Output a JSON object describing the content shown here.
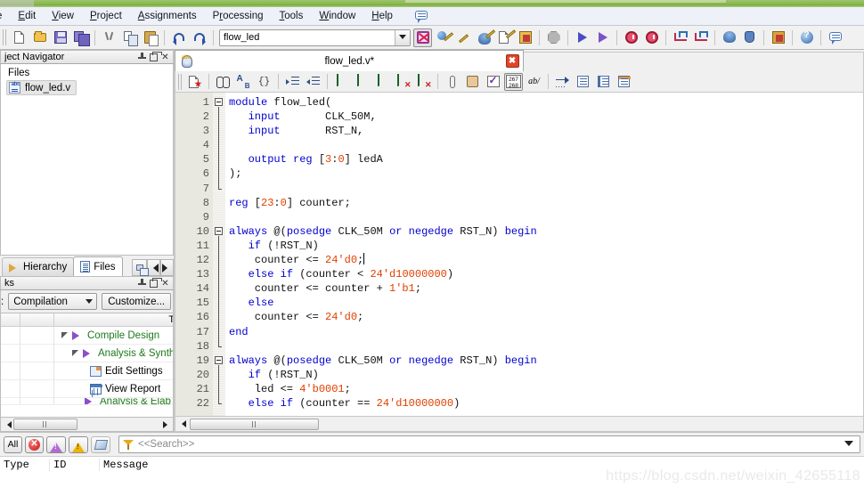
{
  "window": {
    "title_strip_color": "#8fba57"
  },
  "menubar": {
    "items": [
      {
        "label": "e",
        "truncated": true
      },
      {
        "label": "Edit"
      },
      {
        "label": "View"
      },
      {
        "label": "Project"
      },
      {
        "label": "Assignments"
      },
      {
        "label": "Processing"
      },
      {
        "label": "Tools"
      },
      {
        "label": "Window"
      },
      {
        "label": "Help"
      }
    ],
    "note_icon": "message-balloon-icon"
  },
  "toolbar": {
    "project_combo_value": "flow_led",
    "buttons": [
      {
        "name": "new-file-button",
        "icon": "new-document-icon"
      },
      {
        "name": "open-file-button",
        "icon": "open-folder-icon"
      },
      {
        "name": "save-file-button",
        "icon": "save-floppy-icon"
      },
      {
        "name": "save-all-button",
        "icon": "save-all-icon"
      },
      {
        "name": "cut-button",
        "icon": "scissors-icon"
      },
      {
        "name": "copy-button",
        "icon": "copy-icon"
      },
      {
        "name": "paste-button",
        "icon": "paste-icon"
      },
      {
        "name": "undo-button",
        "icon": "undo-arrow-icon"
      },
      {
        "name": "redo-button",
        "icon": "redo-arrow-icon"
      },
      {
        "name": "device-button",
        "icon": "chip-x-icon"
      },
      {
        "name": "assignment-editor-button",
        "icon": "pencil-ball-icon"
      },
      {
        "name": "pin-planner-button",
        "icon": "pencil-icon"
      },
      {
        "name": "settings-button",
        "icon": "settings-pencil-icon"
      },
      {
        "name": "compiler-settings-button",
        "icon": "compiler-pencil-icon"
      },
      {
        "name": "simulator-settings-button",
        "icon": "simulator-icon"
      },
      {
        "name": "stop-button",
        "icon": "stop-sign-icon"
      },
      {
        "name": "start-compilation-button",
        "icon": "play-icon"
      },
      {
        "name": "start-analysis-button",
        "icon": "play-check-icon"
      },
      {
        "name": "timing-analyzer-button",
        "icon": "stopwatch-icon"
      },
      {
        "name": "timing-analyzer-2-button",
        "icon": "stopwatch-2-icon"
      },
      {
        "name": "waveform-button",
        "icon": "waveform-in-icon"
      },
      {
        "name": "waveform-out-button",
        "icon": "waveform-out-icon"
      },
      {
        "name": "programmer-download-button",
        "icon": "download-icon"
      },
      {
        "name": "signaltap-button",
        "icon": "hand-icon"
      },
      {
        "name": "programmer-button",
        "icon": "programmer-icon"
      },
      {
        "name": "help-button",
        "icon": "help-circle-icon"
      },
      {
        "name": "message-button",
        "icon": "message-balloon-icon"
      }
    ]
  },
  "navigator": {
    "title": "ject Navigator",
    "full_title": "Project Navigator",
    "section_label": "Files",
    "file": {
      "name": "flow_led.v",
      "icon": "verilog-file-icon"
    },
    "tabs": [
      {
        "label": "Hierarchy",
        "icon": "hierarchy-icon",
        "active": false
      },
      {
        "label": "Files",
        "icon": "files-icon",
        "active": true
      }
    ]
  },
  "tasks": {
    "title": "ks",
    "full_title": "Tasks",
    "flow_label": ":",
    "flow_value": "Compilation",
    "customize_label": "Customize...",
    "column_header": "Tas",
    "column_header_full": "Task",
    "rows": [
      {
        "label": "Compile Design",
        "indent": 1,
        "icon": "purple-arrow-icon",
        "expander": true,
        "color": "green"
      },
      {
        "label": "Analysis & Synthes",
        "indent": 2,
        "icon": "purple-arrow-icon",
        "expander": true,
        "color": "green"
      },
      {
        "label": "Edit Settings",
        "indent": 3,
        "icon": "edit-settings-icon",
        "expander": false,
        "color": "black"
      },
      {
        "label": "View Report",
        "indent": 3,
        "icon": "view-report-icon",
        "expander": false,
        "color": "black"
      },
      {
        "label": "Analysis & Elab",
        "indent": 3,
        "icon": "purple-arrow-icon",
        "expander": false,
        "color": "green",
        "partial": true
      }
    ]
  },
  "editor": {
    "tab_title": "flow_led.v*",
    "tab_icon": "verilog-blue-icon",
    "close_label": "✖",
    "toolbar_buttons": [
      {
        "name": "insert-template-button",
        "icon": "insert-template-icon"
      },
      {
        "name": "find-button",
        "icon": "binoculars-icon"
      },
      {
        "name": "replace-button",
        "icon": "replace-az-icon"
      },
      {
        "name": "goto-button",
        "icon": "goto-arrow-icon"
      },
      {
        "name": "increase-indent-button",
        "icon": "indent-increase-icon"
      },
      {
        "name": "decrease-indent-button",
        "icon": "indent-decrease-icon"
      },
      {
        "name": "toggle-bookmark-button",
        "icon": "bookmark-icon"
      },
      {
        "name": "next-bookmark-button",
        "icon": "bookmark-next-icon"
      },
      {
        "name": "previous-bookmark-button",
        "icon": "bookmark-prev-icon"
      },
      {
        "name": "clear-bookmark-button",
        "icon": "bookmark-clear-icon"
      },
      {
        "name": "clear-all-bookmarks-button",
        "icon": "bookmark-clear-all-icon"
      },
      {
        "name": "attach-button",
        "icon": "paperclip-icon"
      },
      {
        "name": "script-button",
        "icon": "scroll-icon"
      },
      {
        "name": "syntax-check-button",
        "icon": "check-document-icon"
      },
      {
        "name": "line-numbers-button",
        "icon": "line-numbers-267-268-icon",
        "label_top": "267",
        "label_bottom": "268"
      },
      {
        "name": "toggle-case-button",
        "icon": "ab-slash-icon",
        "label": "ab/"
      },
      {
        "name": "goto-line-button",
        "icon": "goto-line-icon"
      },
      {
        "name": "show-all-button",
        "icon": "page-list-icon"
      },
      {
        "name": "split-view-button",
        "icon": "page-split-icon"
      },
      {
        "name": "header-view-button",
        "icon": "page-header-icon"
      }
    ],
    "first_line": 1,
    "last_line": 22,
    "fold_lines": [
      1,
      10,
      19
    ],
    "code_lines": [
      {
        "n": 1,
        "tokens": [
          {
            "t": "module",
            "c": "kw"
          },
          {
            "t": " flow_led(",
            "c": ""
          }
        ]
      },
      {
        "n": 2,
        "tokens": [
          {
            "t": "   ",
            "c": ""
          },
          {
            "t": "input",
            "c": "kw"
          },
          {
            "t": "       CLK_50M,",
            "c": ""
          }
        ]
      },
      {
        "n": 3,
        "tokens": [
          {
            "t": "   ",
            "c": ""
          },
          {
            "t": "input",
            "c": "kw"
          },
          {
            "t": "       RST_N,",
            "c": ""
          }
        ]
      },
      {
        "n": 4,
        "tokens": []
      },
      {
        "n": 5,
        "tokens": [
          {
            "t": "   ",
            "c": ""
          },
          {
            "t": "output reg",
            "c": "kw"
          },
          {
            "t": " [",
            "c": ""
          },
          {
            "t": "3",
            "c": "num"
          },
          {
            "t": ":",
            "c": ""
          },
          {
            "t": "0",
            "c": "num"
          },
          {
            "t": "] ledA",
            "c": ""
          }
        ]
      },
      {
        "n": 6,
        "tokens": [
          {
            "t": ");",
            "c": ""
          }
        ]
      },
      {
        "n": 7,
        "tokens": []
      },
      {
        "n": 8,
        "tokens": [
          {
            "t": "reg",
            "c": "kw"
          },
          {
            "t": " [",
            "c": ""
          },
          {
            "t": "23",
            "c": "num"
          },
          {
            "t": ":",
            "c": ""
          },
          {
            "t": "0",
            "c": "num"
          },
          {
            "t": "] counter;",
            "c": ""
          }
        ]
      },
      {
        "n": 9,
        "tokens": []
      },
      {
        "n": 10,
        "tokens": [
          {
            "t": "always",
            "c": "kw"
          },
          {
            "t": " @(",
            "c": ""
          },
          {
            "t": "posedge",
            "c": "kw"
          },
          {
            "t": " CLK_50M ",
            "c": ""
          },
          {
            "t": "or",
            "c": "kw"
          },
          {
            "t": " ",
            "c": ""
          },
          {
            "t": "negedge",
            "c": "kw"
          },
          {
            "t": " RST_N) ",
            "c": ""
          },
          {
            "t": "begin",
            "c": "kw"
          }
        ]
      },
      {
        "n": 11,
        "tokens": [
          {
            "t": "   ",
            "c": ""
          },
          {
            "t": "if",
            "c": "kw"
          },
          {
            "t": " (!RST_N)",
            "c": ""
          }
        ]
      },
      {
        "n": 12,
        "tokens": [
          {
            "t": "    counter <= ",
            "c": ""
          },
          {
            "t": "24'd0",
            "c": "num"
          },
          {
            "t": ";",
            "c": ""
          }
        ],
        "cursor_at_end": true
      },
      {
        "n": 13,
        "tokens": [
          {
            "t": "   ",
            "c": ""
          },
          {
            "t": "else if",
            "c": "kw"
          },
          {
            "t": " (counter < ",
            "c": ""
          },
          {
            "t": "24'd10000000",
            "c": "num"
          },
          {
            "t": ")",
            "c": ""
          }
        ]
      },
      {
        "n": 14,
        "tokens": [
          {
            "t": "    counter <= counter + ",
            "c": ""
          },
          {
            "t": "1'b1",
            "c": "num"
          },
          {
            "t": ";",
            "c": ""
          }
        ]
      },
      {
        "n": 15,
        "tokens": [
          {
            "t": "   ",
            "c": ""
          },
          {
            "t": "else",
            "c": "kw"
          }
        ]
      },
      {
        "n": 16,
        "tokens": [
          {
            "t": "    counter <= ",
            "c": ""
          },
          {
            "t": "24'd0",
            "c": "num"
          },
          {
            "t": ";",
            "c": ""
          }
        ]
      },
      {
        "n": 17,
        "tokens": [
          {
            "t": "end",
            "c": "kw"
          }
        ]
      },
      {
        "n": 18,
        "tokens": []
      },
      {
        "n": 19,
        "tokens": [
          {
            "t": "always",
            "c": "kw"
          },
          {
            "t": " @(",
            "c": ""
          },
          {
            "t": "posedge",
            "c": "kw"
          },
          {
            "t": " CLK_50M ",
            "c": ""
          },
          {
            "t": "or",
            "c": "kw"
          },
          {
            "t": " ",
            "c": ""
          },
          {
            "t": "negedge",
            "c": "kw"
          },
          {
            "t": " RST_N) ",
            "c": ""
          },
          {
            "t": "begin",
            "c": "kw"
          }
        ]
      },
      {
        "n": 20,
        "tokens": [
          {
            "t": "   ",
            "c": ""
          },
          {
            "t": "if",
            "c": "kw"
          },
          {
            "t": " (!RST_N)",
            "c": ""
          }
        ]
      },
      {
        "n": 21,
        "tokens": [
          {
            "t": "    led <= ",
            "c": ""
          },
          {
            "t": "4'b0001",
            "c": "num"
          },
          {
            "t": ";",
            "c": ""
          }
        ]
      },
      {
        "n": 22,
        "tokens": [
          {
            "t": "   ",
            "c": ""
          },
          {
            "t": "else if",
            "c": "kw"
          },
          {
            "t": " (counter == ",
            "c": ""
          },
          {
            "t": "24'd10000000",
            "c": "num"
          },
          {
            "t": ")",
            "c": ""
          }
        ]
      }
    ]
  },
  "messages": {
    "filter_all_label": "All",
    "filters": [
      {
        "name": "filter-all-button",
        "label": "All",
        "icon": "all-filter-icon"
      },
      {
        "name": "filter-error-button",
        "label": "",
        "icon": "error-icon"
      },
      {
        "name": "filter-critical-warning-button",
        "label": "",
        "icon": "critical-warning-icon"
      },
      {
        "name": "filter-warning-button",
        "label": "",
        "icon": "warning-icon"
      },
      {
        "name": "filter-info-button",
        "label": "",
        "icon": "info-icon"
      }
    ],
    "search_placeholder": "<<Search>>",
    "search_value": "",
    "columns": [
      "Type",
      "ID",
      "Message"
    ],
    "rows": []
  },
  "watermark": "https://blog.csdn.net/weixin_42655118"
}
